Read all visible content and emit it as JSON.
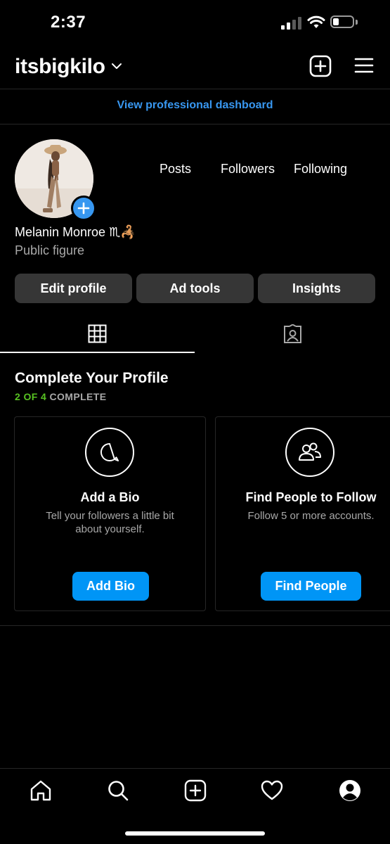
{
  "status_bar": {
    "time": "2:37"
  },
  "header": {
    "username": "itsbigkilo"
  },
  "dashboard_link": "View professional dashboard",
  "profile": {
    "name": "Melanin Monroe",
    "name_emoji": "♏🦂",
    "category": "Public figure",
    "stats": {
      "posts_label": "Posts",
      "followers_label": "Followers",
      "following_label": "Following"
    }
  },
  "actions": {
    "edit_profile": "Edit profile",
    "ad_tools": "Ad tools",
    "insights": "Insights"
  },
  "complete_profile": {
    "title": "Complete Your Profile",
    "progress_count": "2 OF 4",
    "progress_suffix": "COMPLETE",
    "cards": [
      {
        "title": "Add a Bio",
        "desc_line1": "Tell your followers a little bit",
        "desc_line2": "about yourself.",
        "button": "Add Bio",
        "icon": "speech-bubble-icon"
      },
      {
        "title": "Find People to Follow",
        "desc_line1": "Follow 5 or more accounts.",
        "button": "Find People",
        "icon": "people-icon"
      }
    ]
  },
  "colors": {
    "link": "#3897f0",
    "progress_green": "#58c322",
    "primary_button": "#0095f6",
    "secondary_button": "#363636"
  },
  "icons": [
    "chevron-down-icon",
    "new-post-icon",
    "menu-icon",
    "grid-icon",
    "tagged-icon",
    "home-icon",
    "search-icon",
    "create-icon",
    "heart-icon",
    "profile-icon"
  ]
}
